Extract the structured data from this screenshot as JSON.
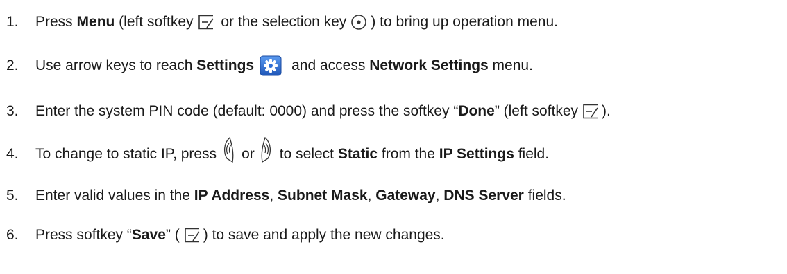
{
  "steps": [
    {
      "number": "1.",
      "t1": "Press ",
      "b1": "Menu",
      "t2": " (left softkey",
      "t3": " or the selection key",
      "t4": ") to bring up operation menu."
    },
    {
      "number": "2.",
      "t1": "Use arrow keys to reach ",
      "b1": "Settings",
      "t2": "and access ",
      "b2": "Network Settings",
      "t3": " menu."
    },
    {
      "number": "3.",
      "t1": "Enter the system PIN code (default: 0000) and press the softkey “",
      "b1": "Done",
      "t2": "” (left softkey",
      "t3": ")."
    },
    {
      "number": "4.",
      "t1": "To change to static IP, press",
      "t2": "or",
      "t3": "to select ",
      "b1": "Static",
      "t4": " from the ",
      "b2": "IP Settings",
      "t5": " field."
    },
    {
      "number": "5.",
      "t1": "Enter valid values in the ",
      "b1": "IP Address",
      "t2": ", ",
      "b2": "Subnet Mask",
      "t3": ", ",
      "b3": "Gateway",
      "t4": ", ",
      "b4": "DNS Server",
      "t5": " fields."
    },
    {
      "number": "6.",
      "t1": "Press softkey “",
      "b1": "Save",
      "t2": "” (",
      "t3": ") to save and apply the new changes."
    }
  ],
  "icons": {
    "softkey": "left-softkey-icon",
    "selection": "selection-key-icon",
    "settings": "settings-gear-icon",
    "left_arrow": "left-arrow-key-icon",
    "right_arrow": "right-arrow-key-icon"
  },
  "colors": {
    "text": "#1a1a1a",
    "settings_icon_bg": "#2f6fd6",
    "settings_icon_gear": "#ffffff"
  }
}
